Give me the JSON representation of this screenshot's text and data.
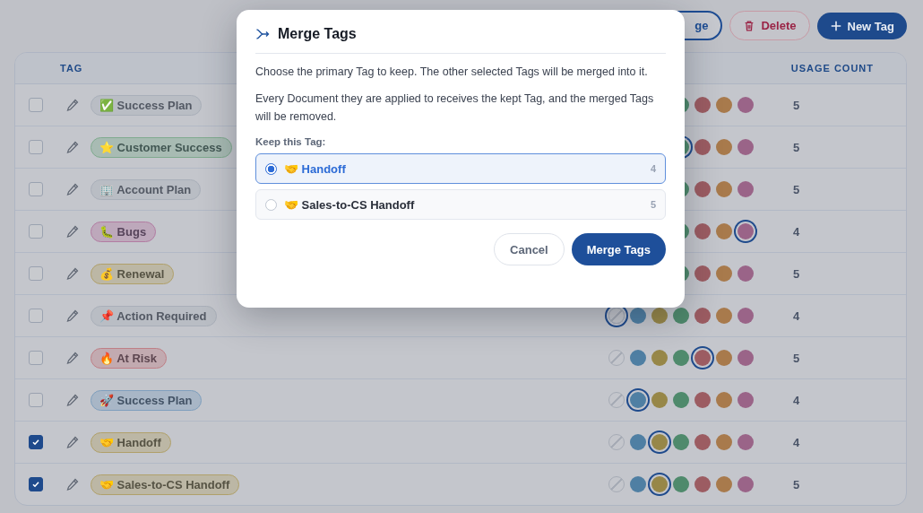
{
  "toolbar": {
    "buttons": [
      {
        "label": "ge",
        "kind": "outline"
      },
      {
        "label": "Delete",
        "kind": "danger"
      },
      {
        "label": "New Tag",
        "kind": "primary"
      }
    ]
  },
  "table": {
    "columns": [
      "TAG",
      "USAGE COUNT"
    ],
    "rows": [
      {
        "checked": false,
        "tag": "✅ Success Plan",
        "color": "#a9afb9",
        "count": "5",
        "swatches": [
          {
            "kind": "color",
            "color": "#4f8a6c",
            "selected": false
          },
          {
            "kind": "color",
            "color": "#9c5c62",
            "selected": false
          },
          {
            "kind": "color",
            "color": "#a87a4c",
            "selected": false
          },
          {
            "kind": "color",
            "color": "#9a6488",
            "selected": false
          }
        ]
      },
      {
        "checked": false,
        "tag": "⭐ Customer Success",
        "color": "#7faa8e",
        "count": "5",
        "swatches": [
          {
            "kind": "color",
            "color": "#4f8a6c",
            "selected": true
          },
          {
            "kind": "color",
            "color": "#9c5c62",
            "selected": false
          },
          {
            "kind": "color",
            "color": "#a87a4c",
            "selected": false
          },
          {
            "kind": "color",
            "color": "#9a6488",
            "selected": false
          }
        ]
      },
      {
        "checked": false,
        "tag": "🏢 Account Plan",
        "color": "#a9afb9",
        "count": "5",
        "swatches": [
          {
            "kind": "color",
            "color": "#4f8a6c",
            "selected": false
          },
          {
            "kind": "color",
            "color": "#9c5c62",
            "selected": false
          },
          {
            "kind": "color",
            "color": "#a87a4c",
            "selected": false
          },
          {
            "kind": "color",
            "color": "#9a6488",
            "selected": false
          }
        ]
      },
      {
        "checked": false,
        "tag": "🐛 Bugs",
        "color": "#b27ca2",
        "count": "4",
        "swatches": [
          {
            "kind": "color",
            "color": "#4f8a6c",
            "selected": false
          },
          {
            "kind": "color",
            "color": "#9c5c62",
            "selected": false
          },
          {
            "kind": "color",
            "color": "#a87a4c",
            "selected": false
          },
          {
            "kind": "color",
            "color": "#9a6488",
            "selected": true
          }
        ]
      },
      {
        "checked": false,
        "tag": "💰 Renewal",
        "color": "#b0a06a",
        "count": "5",
        "swatches": [
          {
            "kind": "color",
            "color": "#4f8a6c",
            "selected": false
          },
          {
            "kind": "color",
            "color": "#9c5c62",
            "selected": false
          },
          {
            "kind": "color",
            "color": "#a87a4c",
            "selected": false
          },
          {
            "kind": "color",
            "color": "#9a6488",
            "selected": false
          }
        ]
      },
      {
        "checked": false,
        "tag": "📌 Action Required",
        "color": "#a9afb9",
        "count": "4",
        "swatches": [
          {
            "kind": "none",
            "selected": true
          },
          {
            "kind": "color",
            "color": "#4f7fa3",
            "selected": false
          },
          {
            "kind": "color",
            "color": "#978748",
            "selected": false
          },
          {
            "kind": "color",
            "color": "#4f8a6c",
            "selected": false
          },
          {
            "kind": "color",
            "color": "#9c5c62",
            "selected": false
          },
          {
            "kind": "color",
            "color": "#a87a4c",
            "selected": false
          },
          {
            "kind": "color",
            "color": "#9a6488",
            "selected": false
          }
        ]
      },
      {
        "checked": false,
        "tag": "🔥 At Risk",
        "color": "#bf7f86",
        "count": "5",
        "swatches": [
          {
            "kind": "none",
            "selected": false
          },
          {
            "kind": "color",
            "color": "#4f7fa3",
            "selected": false
          },
          {
            "kind": "color",
            "color": "#978748",
            "selected": false
          },
          {
            "kind": "color",
            "color": "#4f8a6c",
            "selected": false
          },
          {
            "kind": "color",
            "color": "#9c5c62",
            "selected": true
          },
          {
            "kind": "color",
            "color": "#a87a4c",
            "selected": false
          },
          {
            "kind": "color",
            "color": "#9a6488",
            "selected": false
          }
        ]
      },
      {
        "checked": false,
        "tag": "🚀 Success Plan",
        "color": "#7f9fbd",
        "count": "4",
        "swatches": [
          {
            "kind": "none",
            "selected": false
          },
          {
            "kind": "color",
            "color": "#4f7fa3",
            "selected": true
          },
          {
            "kind": "color",
            "color": "#978748",
            "selected": false
          },
          {
            "kind": "color",
            "color": "#4f8a6c",
            "selected": false
          },
          {
            "kind": "color",
            "color": "#9c5c62",
            "selected": false
          },
          {
            "kind": "color",
            "color": "#a87a4c",
            "selected": false
          },
          {
            "kind": "color",
            "color": "#9a6488",
            "selected": false
          }
        ]
      },
      {
        "checked": true,
        "tag": "🤝 Handoff",
        "color": "#b0a06a",
        "count": "4",
        "swatches": [
          {
            "kind": "none",
            "selected": false
          },
          {
            "kind": "color",
            "color": "#4f7fa3",
            "selected": false
          },
          {
            "kind": "color",
            "color": "#978748",
            "selected": true
          },
          {
            "kind": "color",
            "color": "#4f8a6c",
            "selected": false
          },
          {
            "kind": "color",
            "color": "#9c5c62",
            "selected": false
          },
          {
            "kind": "color",
            "color": "#a87a4c",
            "selected": false
          },
          {
            "kind": "color",
            "color": "#9a6488",
            "selected": false
          }
        ]
      },
      {
        "checked": true,
        "tag": "🤝 Sales-to-CS Handoff",
        "color": "#b0a06a",
        "count": "5",
        "swatches": [
          {
            "kind": "none",
            "selected": false
          },
          {
            "kind": "color",
            "color": "#4f7fa3",
            "selected": false
          },
          {
            "kind": "color",
            "color": "#978748",
            "selected": true
          },
          {
            "kind": "color",
            "color": "#4f8a6c",
            "selected": false
          },
          {
            "kind": "color",
            "color": "#9c5c62",
            "selected": false
          },
          {
            "kind": "color",
            "color": "#a87a4c",
            "selected": false
          },
          {
            "kind": "color",
            "color": "#9a6488",
            "selected": false
          }
        ]
      }
    ]
  },
  "dialog": {
    "title": "Merge Tags",
    "paragraphs": [
      "Choose the primary Tag to keep. The other selected Tags will be merged into it.",
      "Every Document they are applied to receives the kept Tag, and the merged Tags will be removed."
    ],
    "label": "Keep this Tag:",
    "options": [
      {
        "label": "🤝 Handoff",
        "count": "4",
        "selected": true
      },
      {
        "label": "🤝 Sales-to-CS Handoff",
        "count": "5",
        "selected": false
      }
    ],
    "buttons": [
      {
        "label": "Cancel",
        "kind": "secondary"
      },
      {
        "label": "Merge Tags",
        "kind": "primary"
      }
    ]
  }
}
